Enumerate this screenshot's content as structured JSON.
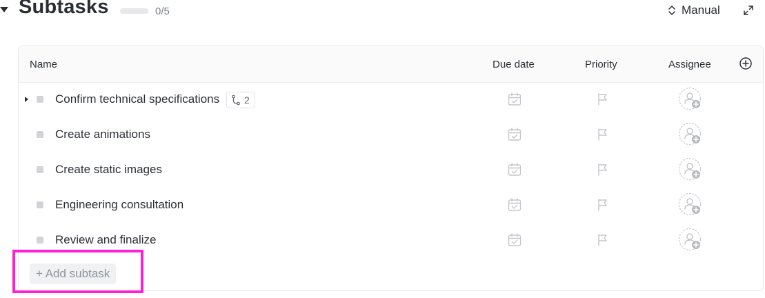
{
  "header": {
    "title": "Subtasks",
    "progress_text": "0/5",
    "progress_fraction": 0,
    "sort_label": "Manual",
    "sort_icon": "sort-updown-icon",
    "expand_icon": "expand-icon"
  },
  "table": {
    "columns": {
      "name": "Name",
      "due_date": "Due date",
      "priority": "Priority",
      "assignee": "Assignee"
    },
    "add_column_icon": "plus-circle-icon",
    "rows": [
      {
        "name": "Confirm technical specifications",
        "has_children": true,
        "subtask_count": "2"
      },
      {
        "name": "Create animations",
        "has_children": false
      },
      {
        "name": "Create static images",
        "has_children": false
      },
      {
        "name": "Engineering consultation",
        "has_children": false
      },
      {
        "name": "Review and finalize",
        "has_children": false
      }
    ]
  },
  "add_subtask_label": "+ Add subtask",
  "colors": {
    "accent": "#7b68ee",
    "highlight": "#ff1fd6",
    "text": "#2a2e34",
    "muted": "#8e939c"
  }
}
